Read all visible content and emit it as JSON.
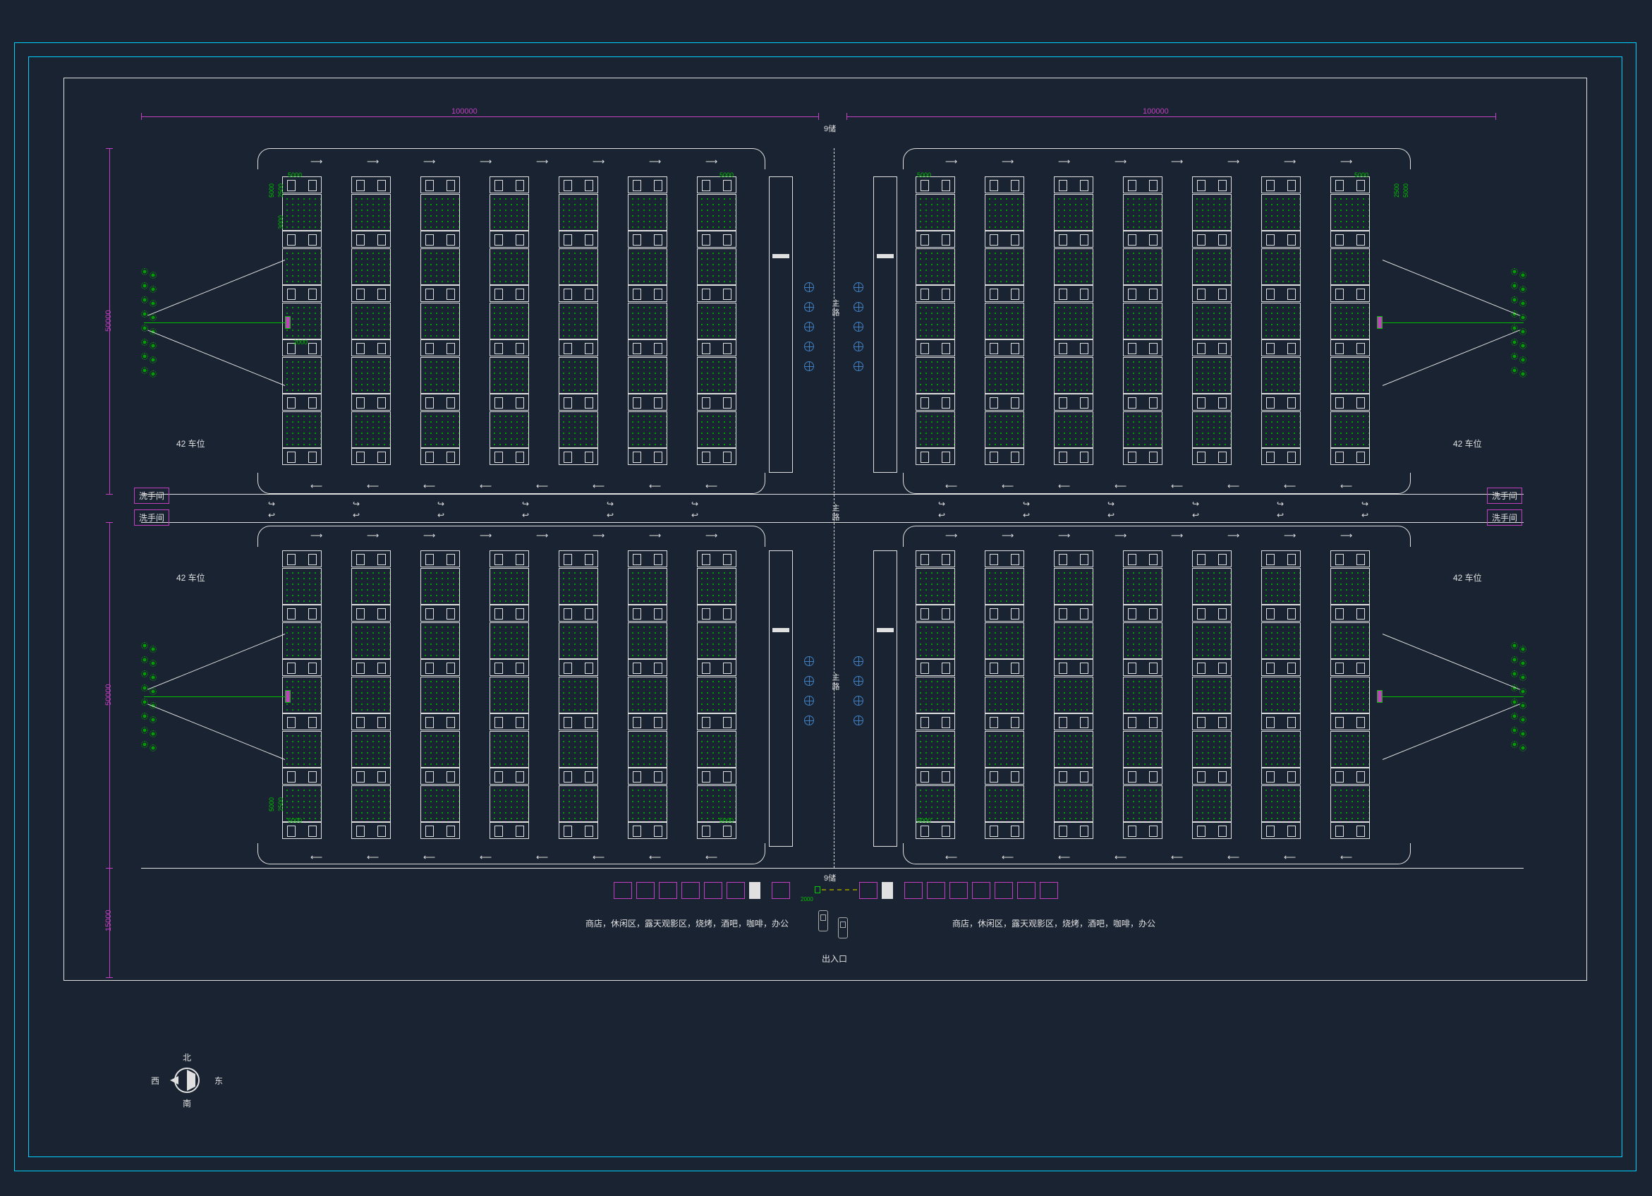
{
  "dimensions": {
    "top_left": "100000",
    "top_right": "100000",
    "center_top": "9储",
    "center_bot": "9储",
    "side_upper": "50000",
    "side_lower": "50000",
    "bottom": "15000",
    "slot_5000": "5000",
    "slot_2500": "2500",
    "slot_3000": "3000",
    "slot_2000": "2000"
  },
  "labels": {
    "parking_count": "42 车位",
    "restroom": "洗手间",
    "main_road": "主路",
    "shops": "商店，休闲区，露天观影区，烧烤，酒吧，咖啡，办公",
    "entrance": "出入口",
    "gate_dim": "2000"
  },
  "compass": {
    "n": "北",
    "s": "南",
    "e": "东",
    "w": "西"
  },
  "colors": {
    "magenta": "#c040c0",
    "white": "#e0e0e0",
    "green": "#00c000",
    "cyan": "#00d0ff",
    "bg": "#1a2332"
  }
}
